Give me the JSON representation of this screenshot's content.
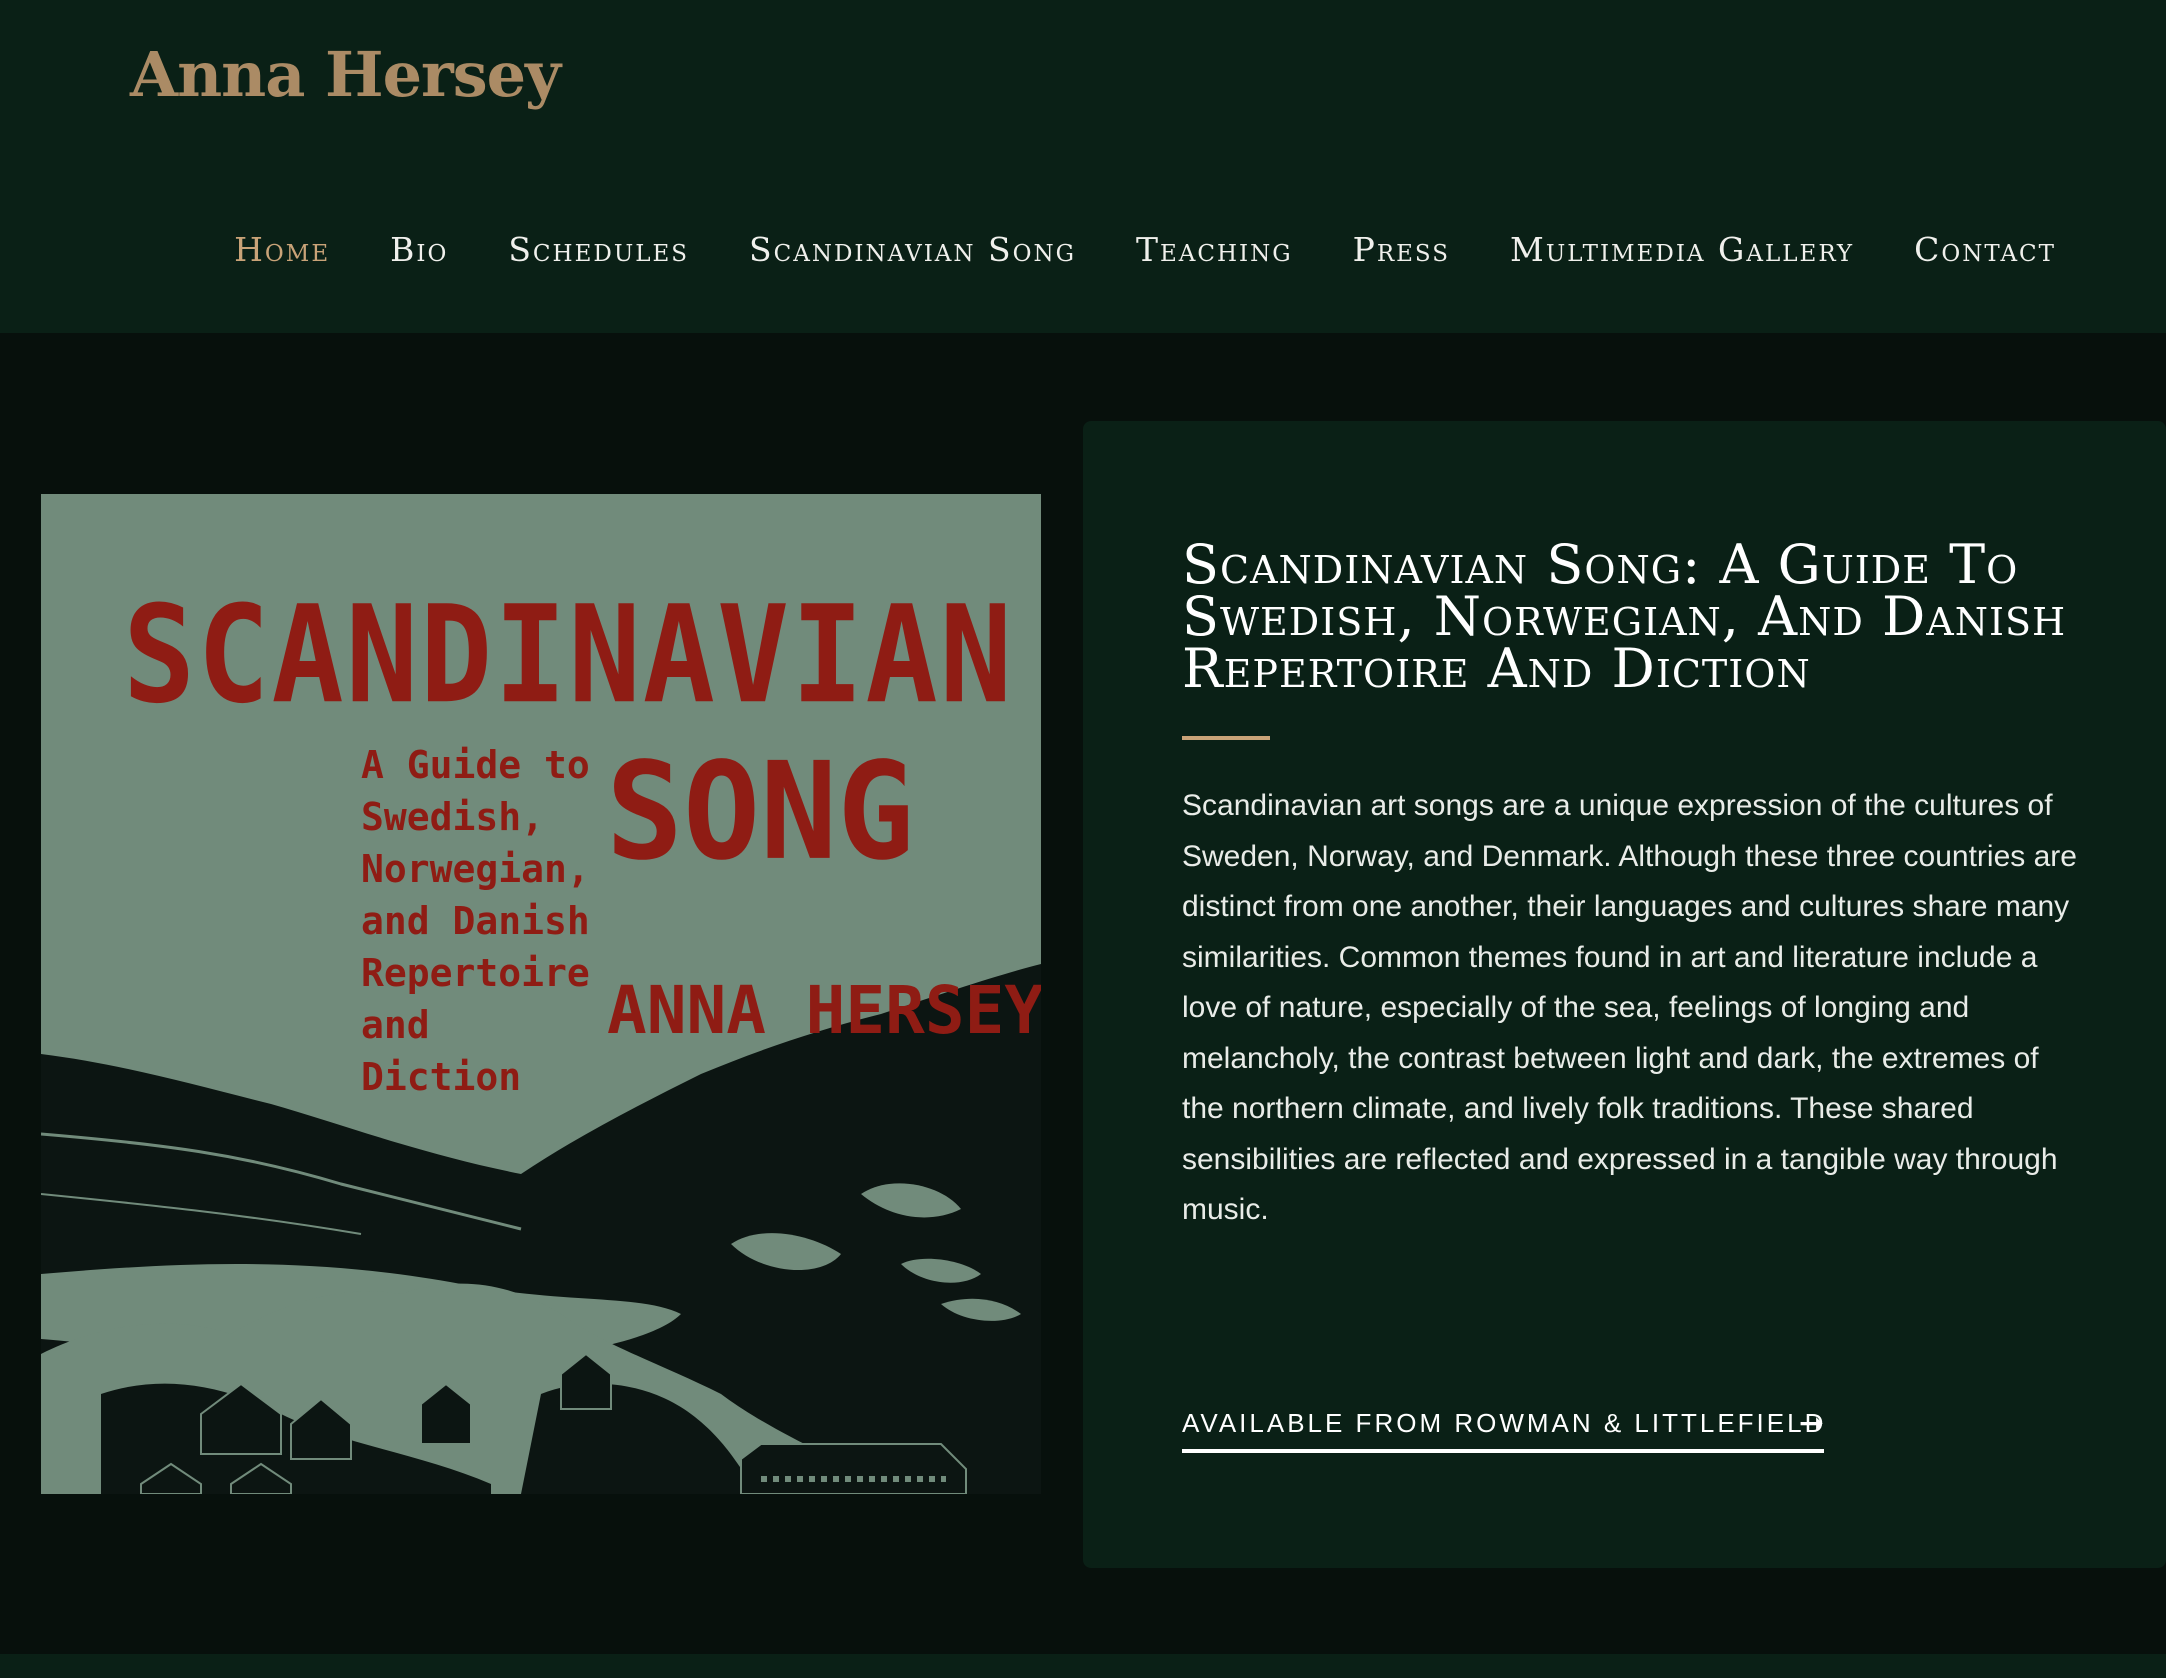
{
  "site": {
    "logo_text": "Anna Hersey"
  },
  "nav": {
    "items": [
      {
        "label": "Home",
        "active": true
      },
      {
        "label": "Bio"
      },
      {
        "label": "Schedules"
      },
      {
        "label": "Scandinavian Song"
      },
      {
        "label": "Teaching"
      },
      {
        "label": "Press"
      },
      {
        "label": "Multimedia Gallery"
      },
      {
        "label": "Contact"
      }
    ]
  },
  "book_cover": {
    "title_line1": "SCANDINAVIAN",
    "title_line2": "SONG",
    "subtitle_lines": [
      "A Guide to",
      "Swedish,",
      "Norwegian,",
      "and Danish",
      "Repertoire",
      "and Diction"
    ],
    "author": "ANNA HERSEY"
  },
  "feature": {
    "title": "Scandinavian Song: A Guide To Swedish, Norwegian, And Danish Repertoire And Diction",
    "description": "Scandinavian art songs are a unique expression of the cultures of Sweden, Norway, and Denmark. Although these three countries are distinct from one another, their languages and cultures share many similarities. Common themes found in art and literature include a love of nature, especially of the sea, feelings of longing and melancholy, the contrast between light and dark, the extremes of the northern climate, and lively folk traditions. These shared sensibilities are reflected and expressed in a tangible way through music.",
    "cta_label": "AVAILABLE FROM ROWMAN & LITTLEFIELD",
    "cta_icon": "arrow-right-icon"
  },
  "colors": {
    "header_bg": "#0a2016",
    "page_bg": "#07100c",
    "accent_gold": "#c9a378",
    "logo_color": "#ab8b65",
    "cover_green": "#718b7b",
    "cover_red": "#8f1c14",
    "cover_dark": "#0c1512"
  }
}
